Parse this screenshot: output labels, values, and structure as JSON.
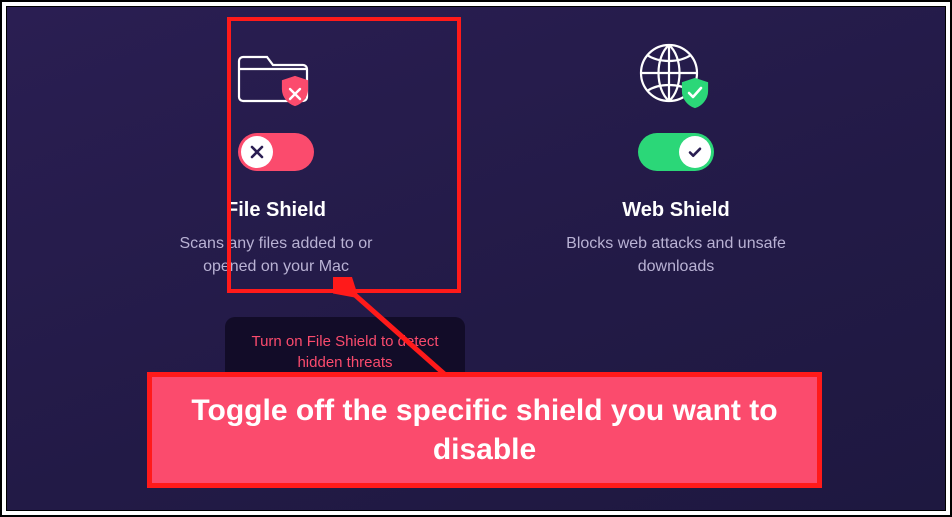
{
  "shields": {
    "file": {
      "title": "File Shield",
      "desc": "Scans any files added to or opened on your Mac",
      "enabled": false
    },
    "web": {
      "title": "Web Shield",
      "desc": "Blocks web attacks and unsafe downloads",
      "enabled": true
    }
  },
  "tooltip": "Turn on File Shield to detect hidden threats",
  "callout": "Toggle off the specific shield you want to disable",
  "icons": {
    "folder_shield": "folder-shield-icon",
    "globe_shield": "globe-shield-icon",
    "x": "x-icon",
    "check": "check-icon"
  },
  "colors": {
    "accent_off": "#fb4b6d",
    "accent_on": "#2bd778",
    "highlight": "#ff1a1a",
    "bg": "#221a46"
  }
}
